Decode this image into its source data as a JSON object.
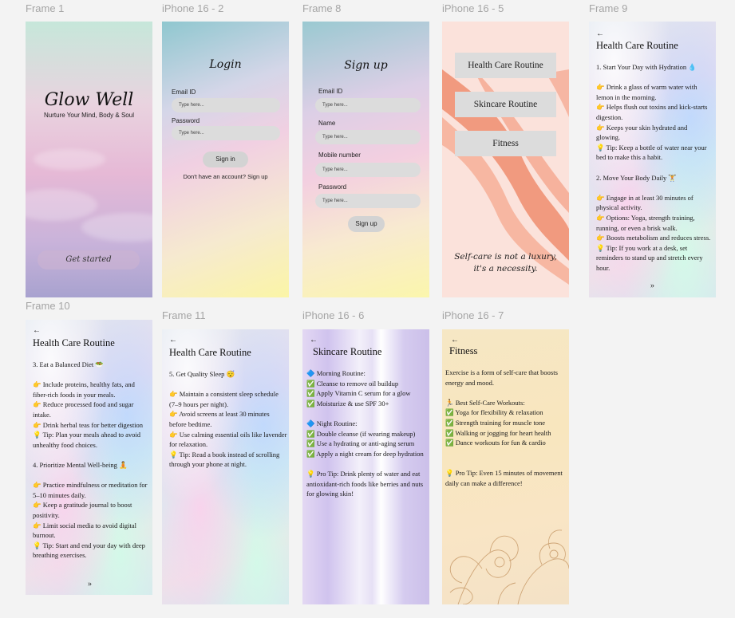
{
  "frame_labels": {
    "frame1": "Frame 1",
    "iphone2": "iPhone 16 - 2",
    "frame8": "Frame 8",
    "iphone5": "iPhone 16 - 5",
    "frame9": "Frame 9",
    "frame10": "Frame 10",
    "frame11": "Frame 11",
    "iphone6": "iPhone 16 - 6",
    "iphone7": "iPhone 16 - 7"
  },
  "splash": {
    "logo": "Glow Well",
    "tagline": "Nurture Your Mind, Body & Soul",
    "button": "Get started"
  },
  "login": {
    "title": "Login",
    "email_label": "Email ID",
    "email_placeholder": "Type here...",
    "password_label": "Password",
    "password_placeholder": "Type here...",
    "button": "Sign in",
    "signup_prompt": "Don't have an account? Sign up"
  },
  "signup": {
    "title": "Sign up",
    "email_label": "Email ID",
    "name_label": "Name",
    "mobile_label": "Mobile number",
    "password_label": "Password",
    "placeholder": "Type here...",
    "button": "Sign up"
  },
  "menu": {
    "items": [
      "Health Care Routine",
      "Skincare Routine",
      "Fitness"
    ],
    "quote_line1": "Self-care is not a luxury,",
    "quote_line2": "it's a necessity."
  },
  "health1": {
    "back": "←",
    "title": "Health Care Routine",
    "lines": [
      "1. Start Your Day with Hydration 💧",
      "",
      "👉 Drink a glass of warm water with lemon in the morning.",
      "👉 Helps flush out toxins and kick-starts digestion.",
      "👉 Keeps your skin hydrated and glowing.",
      "💡 Tip: Keep a bottle of water near your bed to make this a habit.",
      "",
      "2. Move Your Body Daily 🏋",
      "",
      "👉 Engage in at least 30 minutes of physical activity.",
      "👉 Options: Yoga, strength training, running, or even a brisk walk.",
      "👉 Boosts metabolism and reduces stress.",
      "💡 Tip: If you work at a desk, set reminders to stand up and stretch every hour."
    ],
    "next": "»"
  },
  "health2": {
    "back": "←",
    "title": "Health Care Routine",
    "lines": [
      "3. Eat a Balanced Diet 🥗",
      "",
      "👉 Include proteins, healthy fats, and fiber-rich foods in your meals.",
      "👉 Reduce processed food and sugar intake.",
      "👉 Drink herbal teas for better digestion",
      "💡 Tip: Plan your meals ahead to avoid unhealthy food choices.",
      "",
      "4. Prioritize Mental Well-being 🧘",
      "",
      "👉 Practice mindfulness or meditation for 5–10 minutes daily.",
      "👉 Keep a gratitude journal to boost positivity.",
      "👉 Limit social media to avoid digital burnout.",
      "💡 Tip: Start and end your day with deep breathing exercises."
    ],
    "next": "»"
  },
  "health3": {
    "back": "←",
    "title": "Health Care Routine",
    "lines": [
      "5. Get Quality Sleep 😴",
      "",
      "👉 Maintain a consistent sleep schedule (7–9 hours per night).",
      "👉 Avoid screens at least 30 minutes before bedtime.",
      "👉 Use calming essential oils like lavender for relaxation.",
      "💡 Tip: Read a book instead of scrolling through your phone at night."
    ]
  },
  "skincare": {
    "back": "←",
    "title": "Skincare Routine",
    "lines": [
      "🔷 Morning Routine:",
      "✅ Cleanse to remove oil buildup",
      "✅ Apply Vitamin C serum for a glow",
      "✅ Moisturize & use SPF 30+",
      "",
      "🔷 Night Routine:",
      "✅ Double cleanse (if wearing makeup)",
      "✅ Use a hydrating or anti-aging serum",
      "✅ Apply a night cream for deep hydration",
      "",
      "💡 Pro Tip: Drink plenty of water and eat antioxidant-rich foods like berries and nuts for glowing skin!"
    ]
  },
  "fitness": {
    "back": "←",
    "title": "Fitness",
    "lines": [
      "Exercise is a form of self-care that boosts energy and mood.",
      "",
      "🏃 Best Self-Care Workouts:",
      "✅ Yoga for flexibility & relaxation",
      "✅ Strength training for muscle tone",
      "✅ Walking or jogging for heart health",
      "✅ Dance workouts for fun & cardio",
      "",
      "",
      "💡 Pro Tip: Even 15 minutes of movement daily can make a difference!"
    ]
  }
}
